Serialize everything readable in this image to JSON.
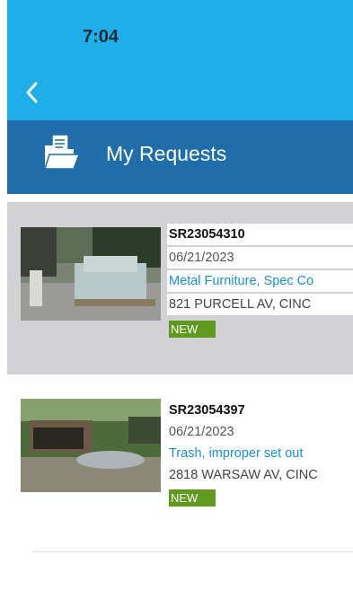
{
  "status_bar": {
    "time": "7:04"
  },
  "header": {
    "title": "My Requests",
    "back_icon": "chevron-left-icon",
    "title_icon": "folder-document-icon"
  },
  "colors": {
    "status_bar_bg": "#1faee9",
    "title_bar_bg": "#1f6da9",
    "category_link": "#1a8fd6",
    "new_badge": "#5f9a1f",
    "selected_row_bg": "#d2d2d4"
  },
  "requests": [
    {
      "id": "SR23054310",
      "date": "06/21/2023",
      "category": "Metal Furniture, Spec Co",
      "address": "821 PURCELL AV, CINC",
      "status": "NEW",
      "selected": true
    },
    {
      "id": "SR23054397",
      "date": "06/21/2023",
      "category": "Trash, improper set out",
      "address": "2818 WARSAW AV, CINC",
      "status": "NEW",
      "selected": false
    }
  ]
}
